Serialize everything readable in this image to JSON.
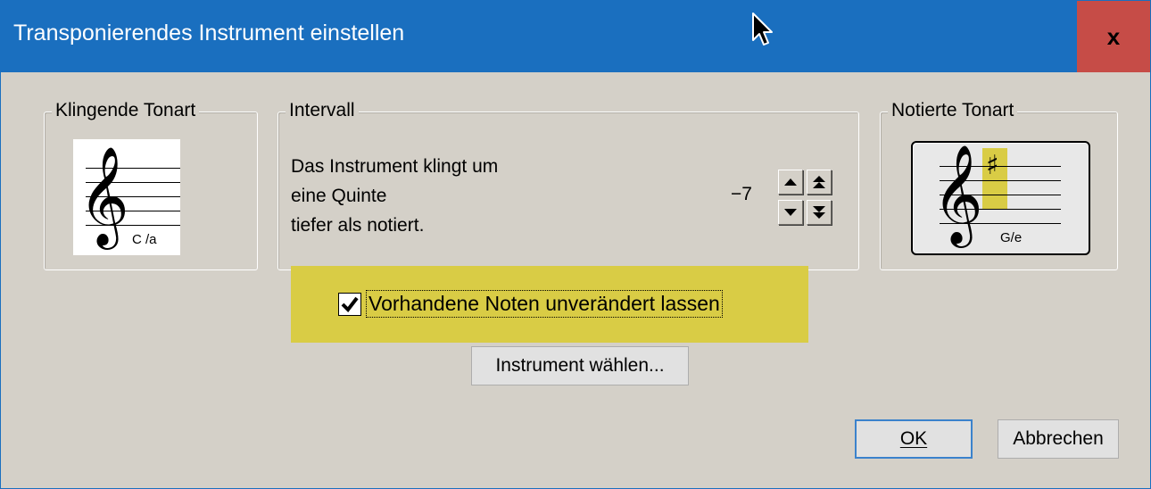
{
  "window": {
    "title": "Transponierendes Instrument einstellen",
    "close_label": "x"
  },
  "sounding_key": {
    "legend": "Klingende Tonart",
    "key_label": "C /a"
  },
  "interval": {
    "legend": "Intervall",
    "line1": "Das Instrument klingt um",
    "line2": "eine Quinte",
    "line3": "tiefer als notiert.",
    "value": "−7"
  },
  "notated_key": {
    "legend": "Notierte Tonart",
    "key_label": "G/e",
    "accidental": "♯"
  },
  "options": {
    "keep_notes_label": "Vorhandene Noten unverändert lassen",
    "keep_notes_checked": true
  },
  "buttons": {
    "choose_instrument": "Instrument wählen...",
    "ok": "OK",
    "cancel": "Abbrechen"
  },
  "colors": {
    "titlebar": "#1a6fbf",
    "close": "#c64c47",
    "highlight": "#d9cc45"
  },
  "icons": [
    "cursor-icon",
    "close-icon",
    "treble-clef-icon",
    "sharp-icon",
    "arrow-up-icon",
    "double-arrow-up-icon",
    "arrow-down-icon",
    "double-arrow-down-icon",
    "checkmark-icon"
  ]
}
